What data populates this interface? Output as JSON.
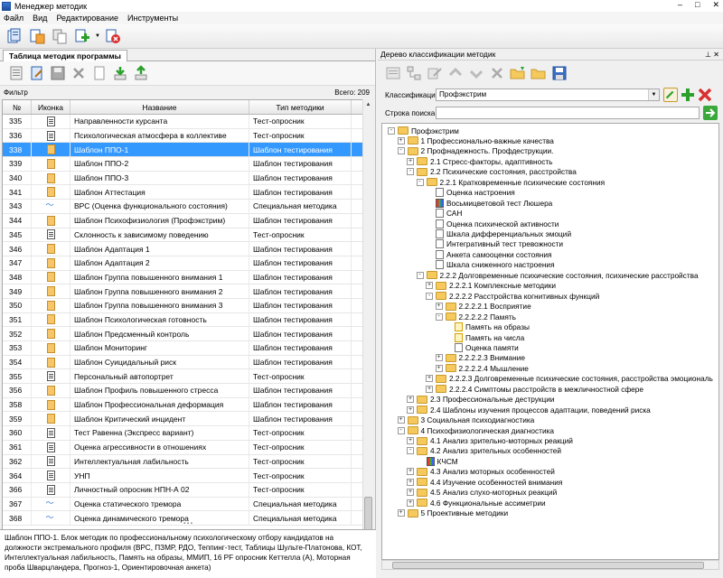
{
  "window": {
    "title": "Менеджер методик"
  },
  "menu": [
    "Файл",
    "Вид",
    "Редактирование",
    "Инструменты"
  ],
  "left": {
    "tab_label": "Таблица методик программы",
    "filter_label": "Фильтр",
    "total_label": "Всего: 209",
    "columns": [
      "№",
      "Иконка",
      "Название",
      "Тип методики"
    ],
    "rows": [
      {
        "num": "335",
        "icon": "test",
        "name": "Направленности курсанта",
        "type": "Тест-опросник"
      },
      {
        "num": "336",
        "icon": "test",
        "name": "Психологическая атмосфера в коллективе",
        "type": "Тест-опросник"
      },
      {
        "num": "338",
        "icon": "tmpl",
        "name": "Шаблон ППО-1",
        "type": "Шаблон тестирования",
        "selected": true
      },
      {
        "num": "339",
        "icon": "tmpl",
        "name": "Шаблон ППО-2",
        "type": "Шаблон тестирования"
      },
      {
        "num": "340",
        "icon": "tmpl",
        "name": "Шаблон ППО-3",
        "type": "Шаблон тестирования"
      },
      {
        "num": "341",
        "icon": "tmpl",
        "name": "Шаблон Аттестация",
        "type": "Шаблон тестирования"
      },
      {
        "num": "343",
        "icon": "spec",
        "name": "ВРС (Оценка функционального состояния)",
        "type": "Специальная методика"
      },
      {
        "num": "344",
        "icon": "tmpl",
        "name": "Шаблон Психофизиология (Профэкстрим)",
        "type": "Шаблон тестирования"
      },
      {
        "num": "345",
        "icon": "test",
        "name": "Склонность к зависимому поведению",
        "type": "Тест-опросник"
      },
      {
        "num": "346",
        "icon": "tmpl",
        "name": "Шаблон Адаптация 1",
        "type": "Шаблон тестирования"
      },
      {
        "num": "347",
        "icon": "tmpl",
        "name": "Шаблон Адаптация 2",
        "type": "Шаблон тестирования"
      },
      {
        "num": "348",
        "icon": "tmpl",
        "name": "Шаблон Группа повышенного внимания 1",
        "type": "Шаблон тестирования"
      },
      {
        "num": "349",
        "icon": "tmpl",
        "name": "Шаблон Группа повышенного внимания 2",
        "type": "Шаблон тестирования"
      },
      {
        "num": "350",
        "icon": "tmpl",
        "name": "Шаблон Группа повышенного внимания 3",
        "type": "Шаблон тестирования"
      },
      {
        "num": "351",
        "icon": "tmpl",
        "name": "Шаблон Психологическая готовность",
        "type": "Шаблон тестирования"
      },
      {
        "num": "352",
        "icon": "tmpl",
        "name": "Шаблон Предсменный контроль",
        "type": "Шаблон тестирования"
      },
      {
        "num": "353",
        "icon": "tmpl",
        "name": "Шаблон Мониторинг",
        "type": "Шаблон тестирования"
      },
      {
        "num": "354",
        "icon": "tmpl",
        "name": "Шаблон Суицидальный риск",
        "type": "Шаблон тестирования"
      },
      {
        "num": "355",
        "icon": "test",
        "name": "Персональный автопортрет",
        "type": "Тест-опросник"
      },
      {
        "num": "356",
        "icon": "tmpl",
        "name": "Шаблон Профиль повышенного стресса",
        "type": "Шаблон тестирования"
      },
      {
        "num": "358",
        "icon": "tmpl",
        "name": "Шаблон Профессиональная деформация",
        "type": "Шаблон тестирования"
      },
      {
        "num": "359",
        "icon": "tmpl",
        "name": "Шаблон Критический инцидент",
        "type": "Шаблон тестирования"
      },
      {
        "num": "360",
        "icon": "test",
        "name": "Тест Равенна (Экспресс вариант)",
        "type": "Тест-опросник"
      },
      {
        "num": "361",
        "icon": "test",
        "name": "Оценка агрессивности в отношениях",
        "type": "Тест-опросник"
      },
      {
        "num": "362",
        "icon": "test",
        "name": "Интеллектуальная лабильность",
        "type": "Тест-опросник"
      },
      {
        "num": "364",
        "icon": "test",
        "name": "УНП",
        "type": "Тест-опросник"
      },
      {
        "num": "366",
        "icon": "test",
        "name": "Личностный опросник НПН-А 02",
        "type": "Тест-опросник"
      },
      {
        "num": "367",
        "icon": "spec",
        "name": "Оценка статического тремора",
        "type": "Специальная методика"
      },
      {
        "num": "368",
        "icon": "spec",
        "name": "Оценка динамического тремора",
        "type": "Специальная методика"
      }
    ],
    "description": "Шаблон ППО-1. Блок методик по профессиональному психологическому отбору кандидатов на должности экстремального профиля (ВРС, ПЗМР, РДО, Теппинг-тест, Таблицы Шульте-Платонова, КОТ, Интеллектуальная лабильность, Память на образы, ММИП, 16 PF опросник Кеттелла (А), Моторная проба Шварцландера, Прогноз-1, Ориентировочная анкета)"
  },
  "right": {
    "panel_title": "Дерево классификации методик",
    "class_label": "Классификации",
    "class_value": "Профэкстрим",
    "search_label": "Строка поиска",
    "tree": [
      {
        "label": "Профэкстрим",
        "level": 0,
        "kind": "folder",
        "exp": "-"
      },
      {
        "label": "1  Профессионально-важные качества",
        "level": 1,
        "kind": "folder",
        "exp": "+"
      },
      {
        "label": "2  Профнадежность. Профдеструкции.",
        "level": 1,
        "kind": "folder",
        "exp": "-"
      },
      {
        "label": "2.1  Стресс-факторы, адаптивность",
        "level": 2,
        "kind": "folder",
        "exp": "+"
      },
      {
        "label": "2.2  Психические состояния, расстройства",
        "level": 2,
        "kind": "folder",
        "exp": "-"
      },
      {
        "label": "2.2.1  Кратковременные психические состояния",
        "level": 3,
        "kind": "folder",
        "exp": "-"
      },
      {
        "label": "Оценка настроения",
        "level": 4,
        "kind": "doc"
      },
      {
        "label": "Восьмицветовой тест Люшера",
        "level": 4,
        "kind": "doc-colored"
      },
      {
        "label": "САН",
        "level": 4,
        "kind": "doc"
      },
      {
        "label": "Оценка психической активности",
        "level": 4,
        "kind": "doc"
      },
      {
        "label": "Шкала дифференциальных эмоций",
        "level": 4,
        "kind": "doc"
      },
      {
        "label": "Интегративный тест тревожности",
        "level": 4,
        "kind": "doc"
      },
      {
        "label": "Анкета самооценки состояния",
        "level": 4,
        "kind": "doc"
      },
      {
        "label": "Шкала сниженного настроения",
        "level": 4,
        "kind": "doc"
      },
      {
        "label": "2.2.2  Долговременные психические состояния, психические расстройства",
        "level": 3,
        "kind": "folder",
        "exp": "-"
      },
      {
        "label": "2.2.2.1  Комплексные методики",
        "level": 4,
        "kind": "folder",
        "exp": "+"
      },
      {
        "label": "2.2.2.2  Расстройства когнитивных функций",
        "level": 4,
        "kind": "folder",
        "exp": "-"
      },
      {
        "label": "2.2.2.2.1  Восприятие",
        "level": 5,
        "kind": "folder",
        "exp": "+"
      },
      {
        "label": "2.2.2.2.2  Память",
        "level": 5,
        "kind": "folder",
        "exp": "-"
      },
      {
        "label": "Память на образы",
        "level": 6,
        "kind": "doc-star"
      },
      {
        "label": "Память на числа",
        "level": 6,
        "kind": "doc-star"
      },
      {
        "label": "Оценка памяти",
        "level": 6,
        "kind": "doc"
      },
      {
        "label": "2.2.2.2.3  Внимание",
        "level": 5,
        "kind": "folder",
        "exp": "+"
      },
      {
        "label": "2.2.2.2.4  Мышление",
        "level": 5,
        "kind": "folder",
        "exp": "+"
      },
      {
        "label": "2.2.2.3  Долговременные психические состояния, расстройства эмоциональ",
        "level": 4,
        "kind": "folder",
        "exp": "+"
      },
      {
        "label": "2.2.2.4  Симптомы расстройств в межличностной сфере",
        "level": 4,
        "kind": "folder",
        "exp": "+"
      },
      {
        "label": "2.3  Профессиональные деструкции",
        "level": 2,
        "kind": "folder",
        "exp": "+"
      },
      {
        "label": "2.4  Шаблоны изучения процессов адаптации, поведений риска",
        "level": 2,
        "kind": "folder",
        "exp": "+"
      },
      {
        "label": "3  Социальная психодиагностика",
        "level": 1,
        "kind": "folder",
        "exp": "+"
      },
      {
        "label": "4  Психофизиологическая диагностика",
        "level": 1,
        "kind": "folder",
        "exp": "-"
      },
      {
        "label": "4.1  Анализ зрительно-моторных реакций",
        "level": 2,
        "kind": "folder",
        "exp": "+"
      },
      {
        "label": "4.2  Анализ зрительных особенностей",
        "level": 2,
        "kind": "folder",
        "exp": "-"
      },
      {
        "label": "КЧСМ",
        "level": 3,
        "kind": "doc-colored"
      },
      {
        "label": "4.3  Анализ моторных особенностей",
        "level": 2,
        "kind": "folder",
        "exp": "+"
      },
      {
        "label": "4.4  Изучение особенностей внимания",
        "level": 2,
        "kind": "folder",
        "exp": "+"
      },
      {
        "label": "4.5  Анализ слухо-моторных реакций",
        "level": 2,
        "kind": "folder",
        "exp": "+"
      },
      {
        "label": "4.6  Функциональные ассиметрии",
        "level": 2,
        "kind": "folder",
        "exp": "+"
      },
      {
        "label": "5  Проективные методики",
        "level": 1,
        "kind": "folder",
        "exp": "+"
      }
    ]
  }
}
